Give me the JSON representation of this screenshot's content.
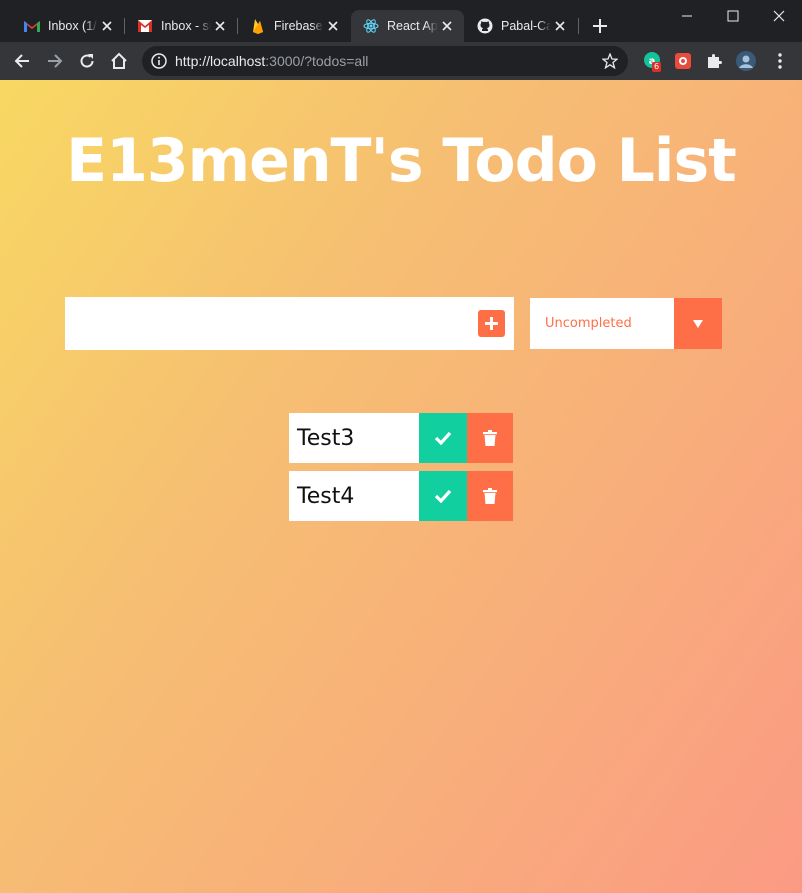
{
  "browser": {
    "tabs": [
      {
        "title": "Inbox (1/",
        "icon": "gmail-icon",
        "active": false
      },
      {
        "title": "Inbox - si",
        "icon": "gmail-icon",
        "active": false
      },
      {
        "title": "Firebase",
        "icon": "firebase-icon",
        "active": false
      },
      {
        "title": "React Ap",
        "icon": "react-icon",
        "active": true
      },
      {
        "title": "Pabal-Ca",
        "icon": "github-icon",
        "active": false
      }
    ],
    "address": {
      "host": "http://localhost",
      "rest": ":3000/?todos=all"
    },
    "extension_badge": "6"
  },
  "app": {
    "title": "E13menT's Todo List",
    "input": {
      "value": "",
      "placeholder": ""
    },
    "filter": {
      "selected": "Uncompleted",
      "options": [
        "Uncompleted"
      ]
    },
    "todos": [
      {
        "text": "Test3"
      },
      {
        "text": "Test4"
      }
    ]
  },
  "colors": {
    "accent": "#ff6f47",
    "complete": "#12cfa0",
    "gradient_start": "#f8d862",
    "gradient_end": "#fb9a84"
  }
}
